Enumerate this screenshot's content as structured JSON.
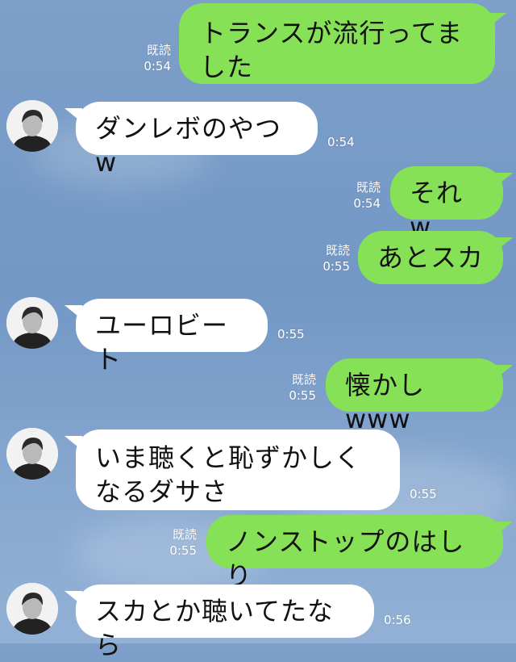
{
  "chat": {
    "messages": [
      {
        "id": "m1",
        "direction": "out",
        "text": "トランスが流行ってました",
        "read_label": "既読",
        "time": "0:54"
      },
      {
        "id": "m2",
        "direction": "in",
        "text": "ダンレボのやつw",
        "time": "0:54"
      },
      {
        "id": "m3",
        "direction": "out",
        "text": "それw",
        "read_label": "既読",
        "time": "0:54"
      },
      {
        "id": "m4",
        "direction": "out",
        "text": "あとスカ",
        "read_label": "既読",
        "time": "0:55"
      },
      {
        "id": "m5",
        "direction": "in",
        "text": "ユーロビート",
        "time": "0:55"
      },
      {
        "id": "m6",
        "direction": "out",
        "text": "懐かしwww",
        "read_label": "既読",
        "time": "0:55"
      },
      {
        "id": "m7",
        "direction": "in",
        "text": "いま聴くと恥ずかしくなるダサさ",
        "time": "0:55"
      },
      {
        "id": "m8",
        "direction": "out",
        "text": "ノンストップのはしり",
        "read_label": "既読",
        "time": "0:55"
      },
      {
        "id": "m9",
        "direction": "in",
        "text": "スカとか聴いてたなら",
        "time": "0:56"
      }
    ]
  },
  "theme": {
    "outgoing_bubble": "#86e157",
    "incoming_bubble": "#ffffff",
    "background": "#7d9fc9"
  },
  "icons": {
    "avatar": "contact-avatar-icon"
  }
}
